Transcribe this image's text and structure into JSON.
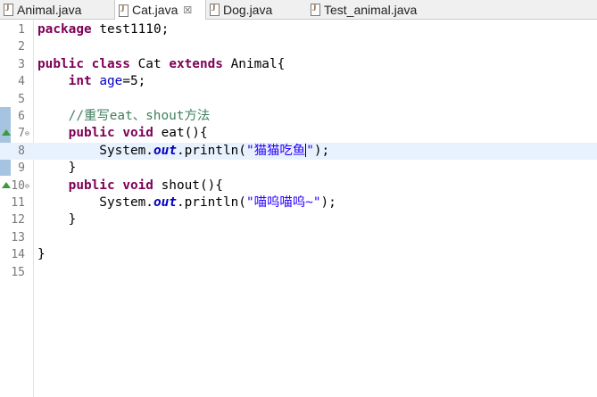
{
  "tabs": [
    {
      "label": "Animal.java",
      "active": false
    },
    {
      "label": "Cat.java",
      "active": true,
      "close": "☒"
    },
    {
      "label": "Dog.java",
      "active": false
    },
    {
      "label": "Test_animal.java",
      "active": false
    }
  ],
  "lines": [
    {
      "num": "1",
      "segments": [
        {
          "t": "package",
          "c": "kw"
        },
        {
          "t": " test1110;"
        }
      ]
    },
    {
      "num": "2",
      "segments": []
    },
    {
      "num": "3",
      "segments": [
        {
          "t": "public",
          "c": "kw"
        },
        {
          "t": " "
        },
        {
          "t": "class",
          "c": "kw"
        },
        {
          "t": " Cat "
        },
        {
          "t": "extends",
          "c": "kw"
        },
        {
          "t": " Animal{"
        }
      ]
    },
    {
      "num": "4",
      "segments": [
        {
          "t": "    "
        },
        {
          "t": "int",
          "c": "kw"
        },
        {
          "t": " "
        },
        {
          "t": "age",
          "c": "field"
        },
        {
          "t": "=5;"
        }
      ]
    },
    {
      "num": "5",
      "segments": []
    },
    {
      "num": "6",
      "segments": [
        {
          "t": "    "
        },
        {
          "t": "//重写eat、shout方法",
          "c": "cmt"
        }
      ]
    },
    {
      "num": "7",
      "fold": "⊖",
      "override": true,
      "segments": [
        {
          "t": "    "
        },
        {
          "t": "public",
          "c": "kw"
        },
        {
          "t": " "
        },
        {
          "t": "void",
          "c": "kw"
        },
        {
          "t": " eat(){"
        }
      ]
    },
    {
      "num": "8",
      "current": true,
      "segments": [
        {
          "t": "        System."
        },
        {
          "t": "out",
          "c": "static"
        },
        {
          "t": ".println("
        },
        {
          "t": "\"猫猫吃鱼",
          "c": "str"
        },
        {
          "caret": true
        },
        {
          "t": "\"",
          "c": "str"
        },
        {
          "t": ");"
        }
      ]
    },
    {
      "num": "9",
      "segments": [
        {
          "t": "    }"
        }
      ]
    },
    {
      "num": "10",
      "fold": "⊖",
      "override": true,
      "segments": [
        {
          "t": "    "
        },
        {
          "t": "public",
          "c": "kw"
        },
        {
          "t": " "
        },
        {
          "t": "void",
          "c": "kw"
        },
        {
          "t": " shout(){"
        }
      ]
    },
    {
      "num": "11",
      "segments": [
        {
          "t": "        System."
        },
        {
          "t": "out",
          "c": "static"
        },
        {
          "t": ".println("
        },
        {
          "t": "\"喵呜喵呜~\"",
          "c": "str"
        },
        {
          "t": ");"
        }
      ]
    },
    {
      "num": "12",
      "segments": [
        {
          "t": "    }"
        }
      ]
    },
    {
      "num": "13",
      "segments": []
    },
    {
      "num": "14",
      "segments": [
        {
          "t": "}"
        }
      ]
    },
    {
      "num": "15",
      "segments": []
    }
  ]
}
